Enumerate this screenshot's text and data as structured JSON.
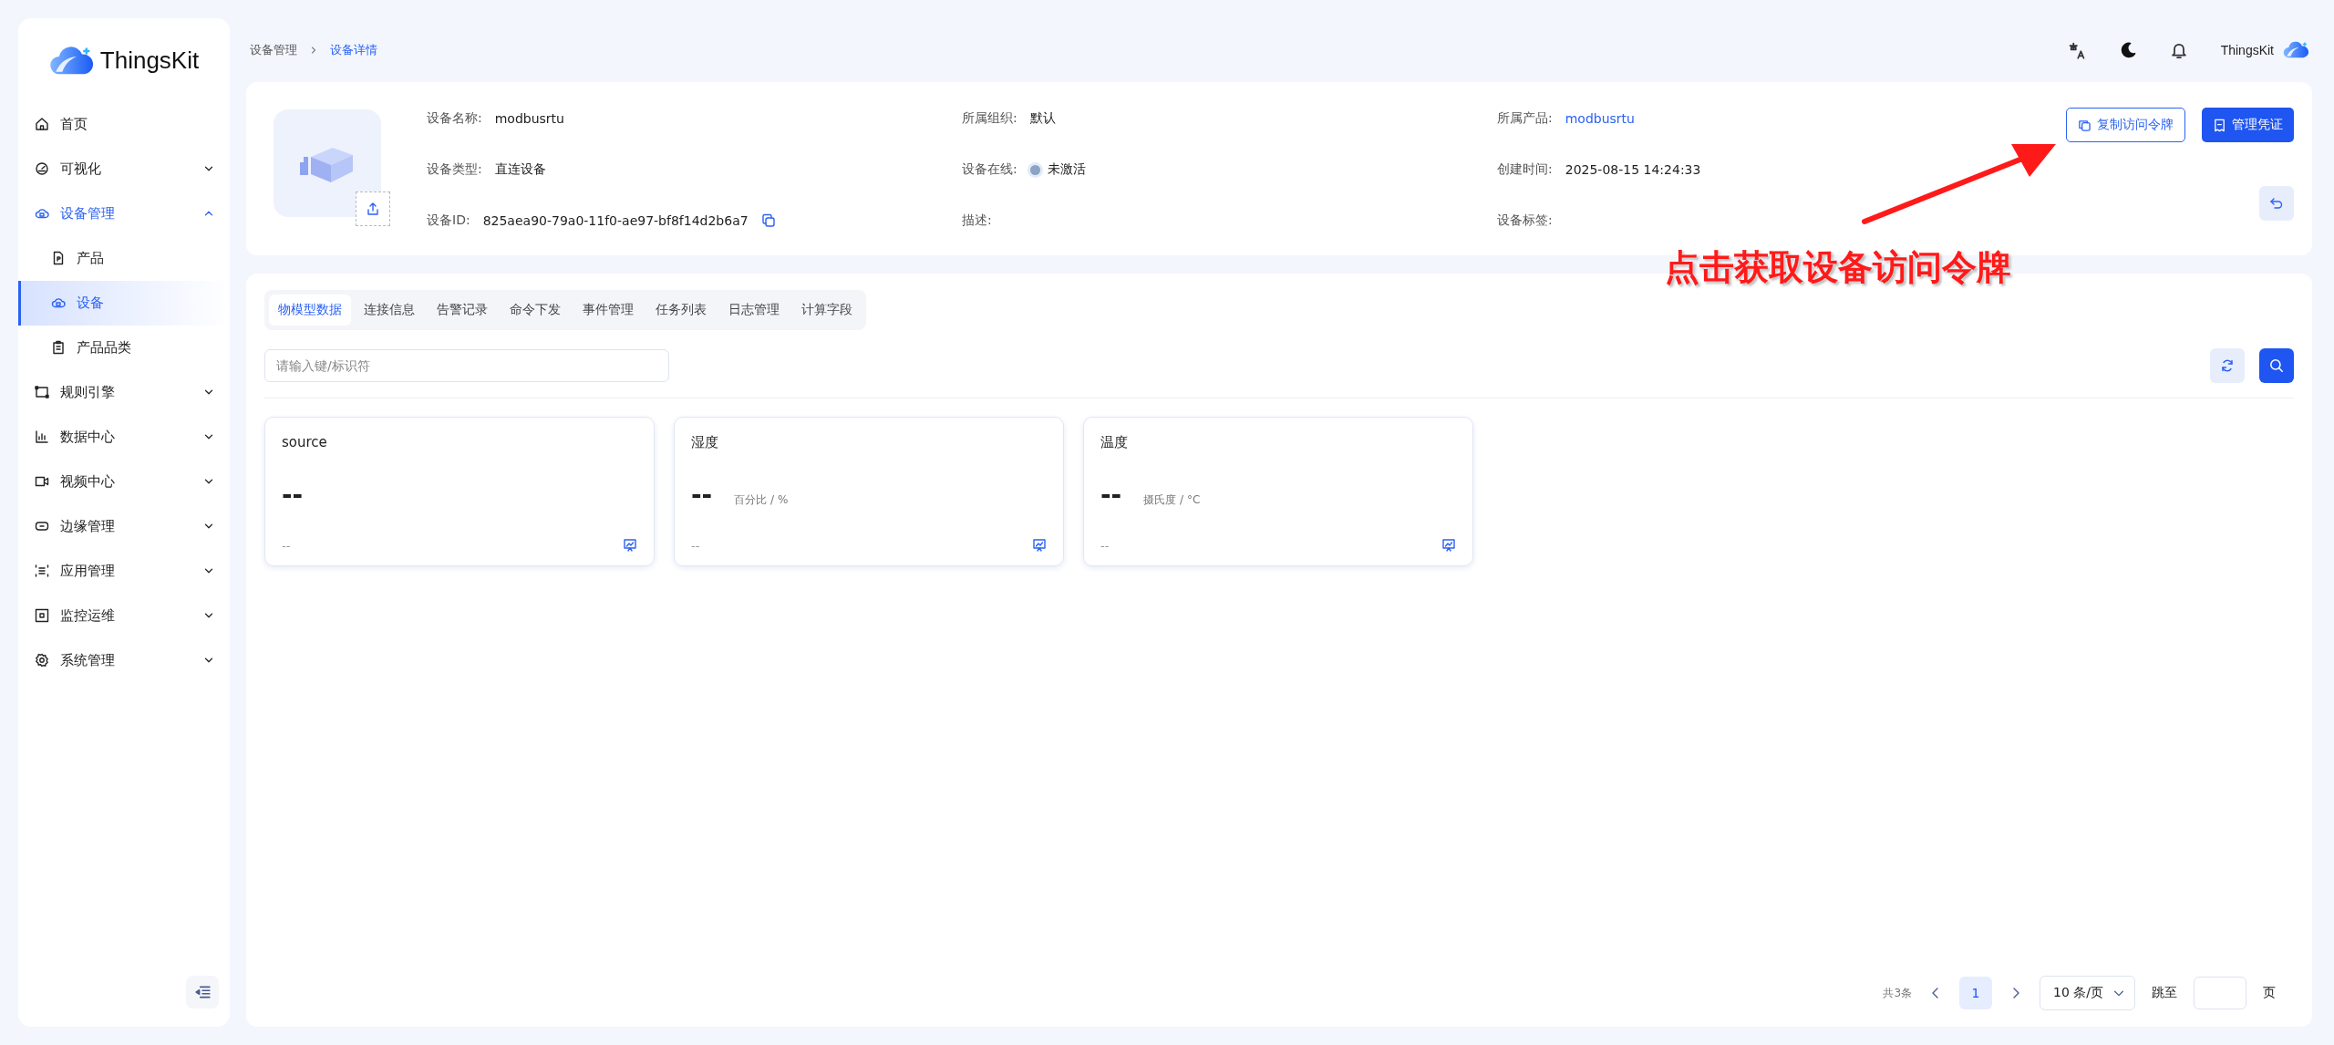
{
  "sidebar": {
    "logo": "ThingsKit",
    "items": [
      {
        "label": "首页"
      },
      {
        "label": "可视化",
        "expanded": false
      },
      {
        "label": "设备管理",
        "expanded": true,
        "selected": false,
        "children": [
          {
            "label": "产品",
            "selected": false
          },
          {
            "label": "设备",
            "selected": true
          },
          {
            "label": "产品品类",
            "selected": false
          }
        ]
      },
      {
        "label": "规则引擎",
        "expanded": false
      },
      {
        "label": "数据中心",
        "expanded": false
      },
      {
        "label": "视频中心",
        "expanded": false
      },
      {
        "label": "边缘管理",
        "expanded": false
      },
      {
        "label": "应用管理",
        "expanded": false
      },
      {
        "label": "监控运维",
        "expanded": false
      },
      {
        "label": "系统管理",
        "expanded": false
      }
    ]
  },
  "breadcrumb": [
    "设备管理",
    "设备详情"
  ],
  "header": {
    "user": "ThingsKit"
  },
  "device": {
    "fields": [
      {
        "label": "设备名称:",
        "value": "modbusrtu",
        "kind": "text"
      },
      {
        "label": "所属组织:",
        "value": "默认",
        "kind": "text"
      },
      {
        "label": "所属产品:",
        "value": "modbusrtu",
        "kind": "link"
      },
      {
        "label": "设备类型:",
        "value": "直连设备",
        "kind": "text"
      },
      {
        "label": "设备在线:",
        "value": "未激活",
        "kind": "status"
      },
      {
        "label": "创建时间:",
        "value": "2025-08-15 14:24:33",
        "kind": "text"
      },
      {
        "label": "设备ID:",
        "value": "825aea90-79a0-11f0-ae97-bf8f14d2b6a7",
        "kind": "copy"
      },
      {
        "label": "描述:"
      },
      {
        "label": "设备标签:"
      }
    ],
    "buttons": [
      "复制访问令牌",
      "管理凭证"
    ]
  },
  "annotation": "点击获取设备访问令牌",
  "tabs": [
    {
      "label": "物模型数据",
      "selected": true
    },
    {
      "label": "连接信息",
      "selected": false
    },
    {
      "label": "告警记录",
      "selected": false
    },
    {
      "label": "命令下发",
      "selected": false
    },
    {
      "label": "事件管理",
      "selected": false
    },
    {
      "label": "任务列表",
      "selected": false
    },
    {
      "label": "日志管理",
      "selected": false
    },
    {
      "label": "计算字段",
      "selected": false
    }
  ],
  "search": {
    "placeholder": "请输入键/标识符"
  },
  "cards": [
    {
      "name": "source",
      "value": "--",
      "time": "--"
    },
    {
      "name": "湿度",
      "value": "--",
      "unit": "百分比 / %",
      "time": "--"
    },
    {
      "name": "温度",
      "value": "--",
      "unit": "摄氏度 / °C",
      "time": "--"
    }
  ],
  "pagination": {
    "total": "共3条",
    "pages": [
      {
        "label": "1",
        "selected": true
      }
    ],
    "page_size": "10 条/页",
    "jump_label": "跳至",
    "page_suffix": "页"
  }
}
